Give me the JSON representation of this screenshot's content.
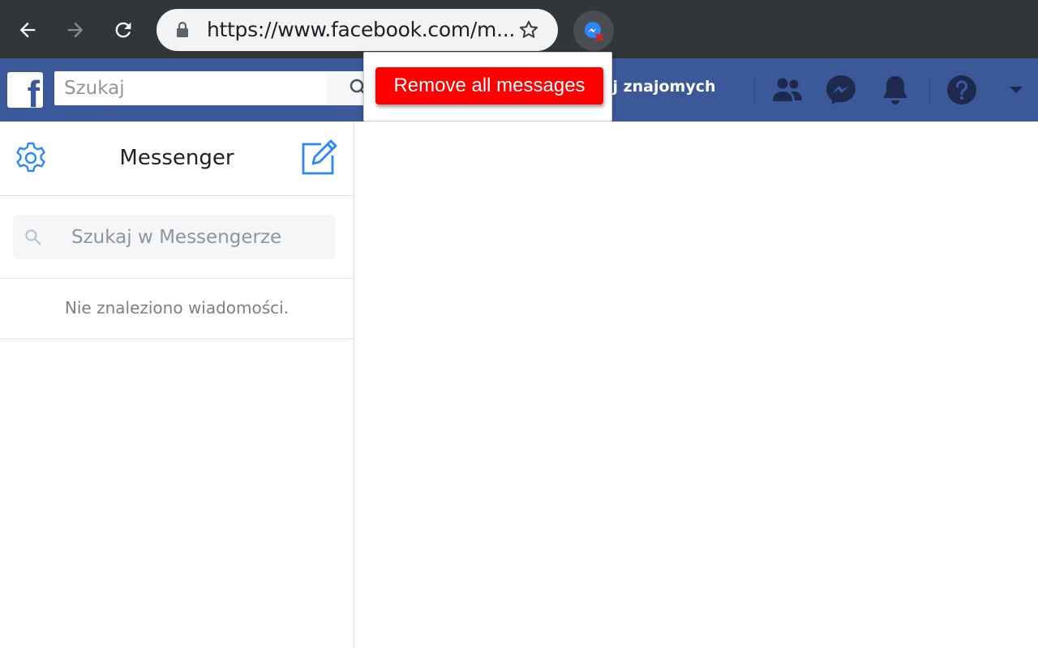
{
  "browser": {
    "url": "https://www.facebook.com/m...",
    "icons": [
      "back-arrow-icon",
      "forward-arrow-icon",
      "reload-icon",
      "lock-icon",
      "star-icon",
      "messenger-remover-extension-icon"
    ]
  },
  "header": {
    "logo": "f",
    "search_placeholder": "Szukaj",
    "find_friends_label": "kaj znajomych",
    "icons": [
      "friends-icon",
      "messenger-icon",
      "notifications-bell-icon",
      "help-icon",
      "caret-down-icon"
    ]
  },
  "popup": {
    "button_label": "Remove all messages"
  },
  "sidebar": {
    "title": "Messenger",
    "search_placeholder": "Szukaj w Messengerze",
    "empty_message": "Nie znaleziono wiadomości.",
    "icons": [
      "settings-gear-icon",
      "compose-icon",
      "search-icon"
    ]
  },
  "colors": {
    "browser_bar": "#323639",
    "facebook_blue": "#3b5998",
    "header_icon": "#1d2a4d",
    "messenger_accent": "#2d88ff",
    "remove_button": "#fe0000"
  }
}
